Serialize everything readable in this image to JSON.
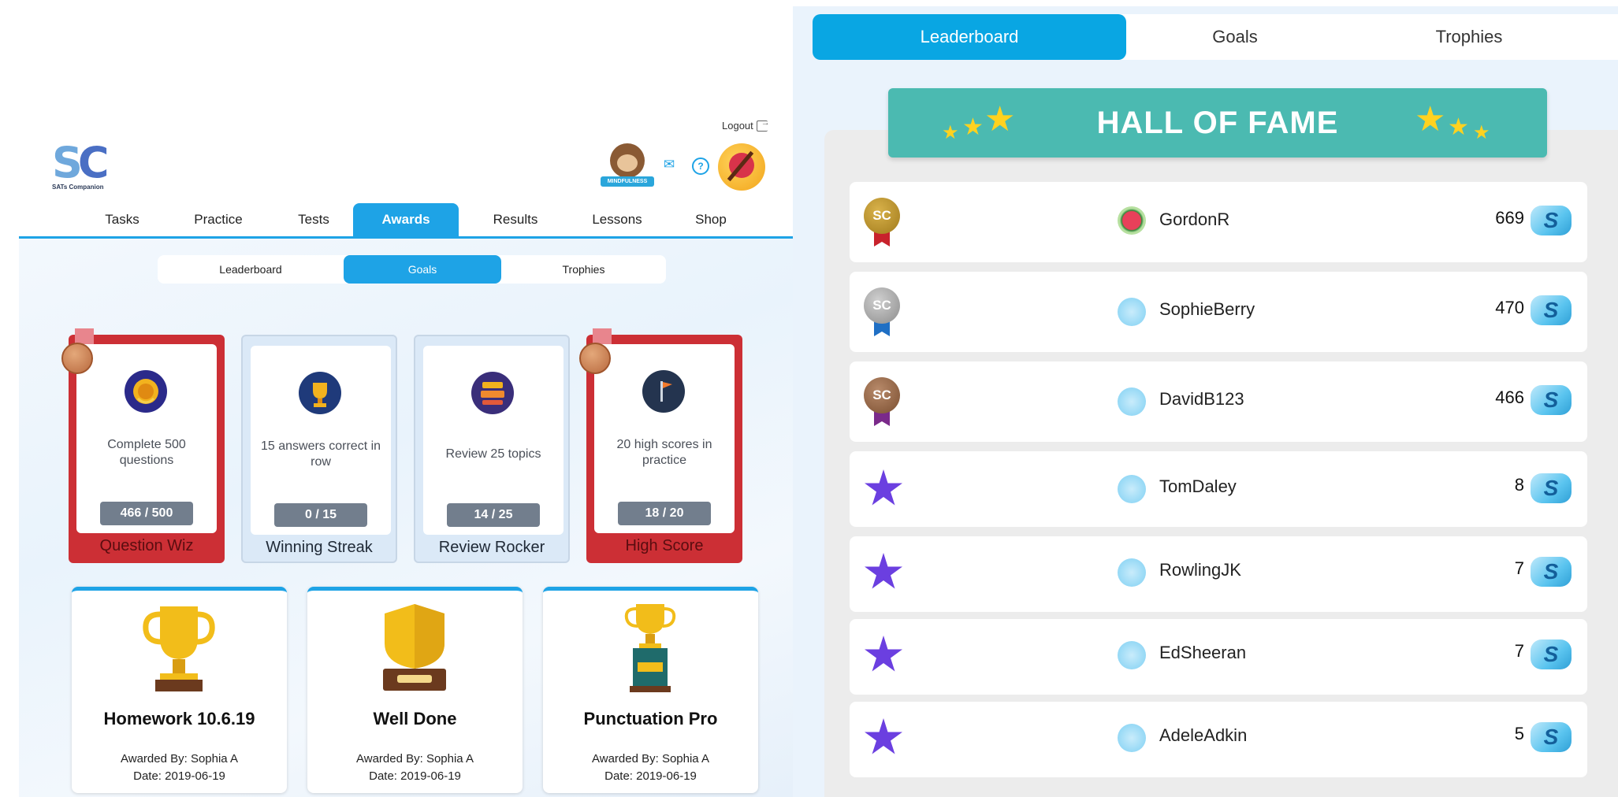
{
  "header": {
    "logo_mark_s": "S",
    "logo_mark_c": "C",
    "logo_text": "SATs Companion",
    "logout_label": "Logout",
    "mindfulness_label": "MINDFULNESS",
    "mail_icon": "✉",
    "help_icon": "?"
  },
  "main_nav": {
    "tabs": [
      {
        "label": "Tasks"
      },
      {
        "label": "Practice"
      },
      {
        "label": "Tests"
      },
      {
        "label": "Awards",
        "active": true
      },
      {
        "label": "Results"
      },
      {
        "label": "Lessons"
      },
      {
        "label": "Shop"
      }
    ]
  },
  "sub_nav": {
    "tabs": [
      {
        "label": "Leaderboard"
      },
      {
        "label": "Goals",
        "active": true
      },
      {
        "label": "Trophies"
      }
    ]
  },
  "goals": [
    {
      "title": "Question Wiz",
      "desc": "Complete 500 questions",
      "progress": "466 / 500",
      "achieved": true,
      "icon": "wreath-medal-icon",
      "icon_color": "#e1a21c"
    },
    {
      "title": "Winning Streak",
      "desc": "15 answers correct in row",
      "progress": "0 / 15",
      "achieved": false,
      "icon": "trophy-icon",
      "icon_color": "#f2b21e"
    },
    {
      "title": "Review Rocker",
      "desc": "Review 25 topics",
      "progress": "14 / 25",
      "achieved": false,
      "icon": "password-icon",
      "icon_color": "#f08a2e"
    },
    {
      "title": "High Score",
      "desc": "20 high scores in practice",
      "progress": "18 / 20",
      "achieved": true,
      "icon": "flag-icon",
      "icon_color": "#f37a2b"
    }
  ],
  "trophies": [
    {
      "name": "Homework 10.6.19",
      "awarded_by": "Awarded By: Sophia A",
      "date": "Date: 2019-06-19",
      "icon": "gold-cup-icon"
    },
    {
      "name": "Well Done",
      "awarded_by": "Awarded By: Sophia A",
      "date": "Date: 2019-06-19",
      "icon": "shield-trophy-icon"
    },
    {
      "name": "Punctuation Pro",
      "awarded_by": "Awarded By: Sophia A",
      "date": "Date: 2019-06-19",
      "icon": "pedestal-trophy-icon"
    }
  ],
  "right_tabs": {
    "tabs": [
      {
        "label": "Leaderboard",
        "active": true
      },
      {
        "label": "Goals"
      },
      {
        "label": "Trophies"
      }
    ]
  },
  "hall_of_fame": {
    "title": "HALL OF FAME"
  },
  "leaderboard": {
    "coin_symbol": "S",
    "rows": [
      {
        "rank_type": "gold",
        "medal_text": "SC",
        "name": "GordonR",
        "points": "669",
        "user_icon": "watermelon-icon"
      },
      {
        "rank_type": "silver",
        "medal_text": "SC",
        "name": "SophieBerry",
        "points": "470",
        "user_icon": "sc-badge-icon"
      },
      {
        "rank_type": "bronze",
        "medal_text": "SC",
        "name": "DavidB123",
        "points": "466",
        "user_icon": "sc-badge-icon"
      },
      {
        "rank_type": "star",
        "name": "TomDaley",
        "points": "8",
        "user_icon": "sc-badge-icon"
      },
      {
        "rank_type": "star",
        "name": "RowlingJK",
        "points": "7",
        "user_icon": "sc-badge-icon"
      },
      {
        "rank_type": "star",
        "name": "EdSheeran",
        "points": "7",
        "user_icon": "sc-badge-icon"
      },
      {
        "rank_type": "star",
        "name": "AdeleAdkin",
        "points": "5",
        "user_icon": "sc-badge-icon"
      }
    ]
  },
  "colors": {
    "accent_blue": "#1ea3e6",
    "achieved_red": "#cc2f35",
    "hall_of_fame_teal": "#4bbab1",
    "star_purple": "#6b3fe0"
  }
}
